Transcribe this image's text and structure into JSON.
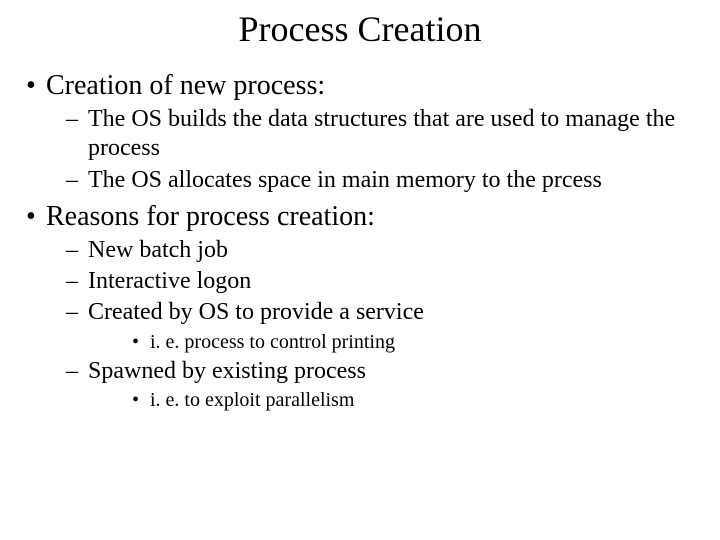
{
  "title": "Process Creation",
  "bullets": [
    {
      "text": "Creation of new process:",
      "sub": [
        {
          "text": "The OS builds the data structures that are used to manage the process"
        },
        {
          "text": "The OS allocates space in main memory to the prcess"
        }
      ]
    },
    {
      "text": "Reasons for process creation:",
      "sub": [
        {
          "text": "New batch job"
        },
        {
          "text": "Interactive logon"
        },
        {
          "text": "Created by OS to provide a service",
          "sub": [
            {
              "text": "i. e. process to control printing"
            }
          ]
        },
        {
          "text": "Spawned by existing process",
          "sub": [
            {
              "text": "i. e. to exploit parallelism"
            }
          ]
        }
      ]
    }
  ]
}
